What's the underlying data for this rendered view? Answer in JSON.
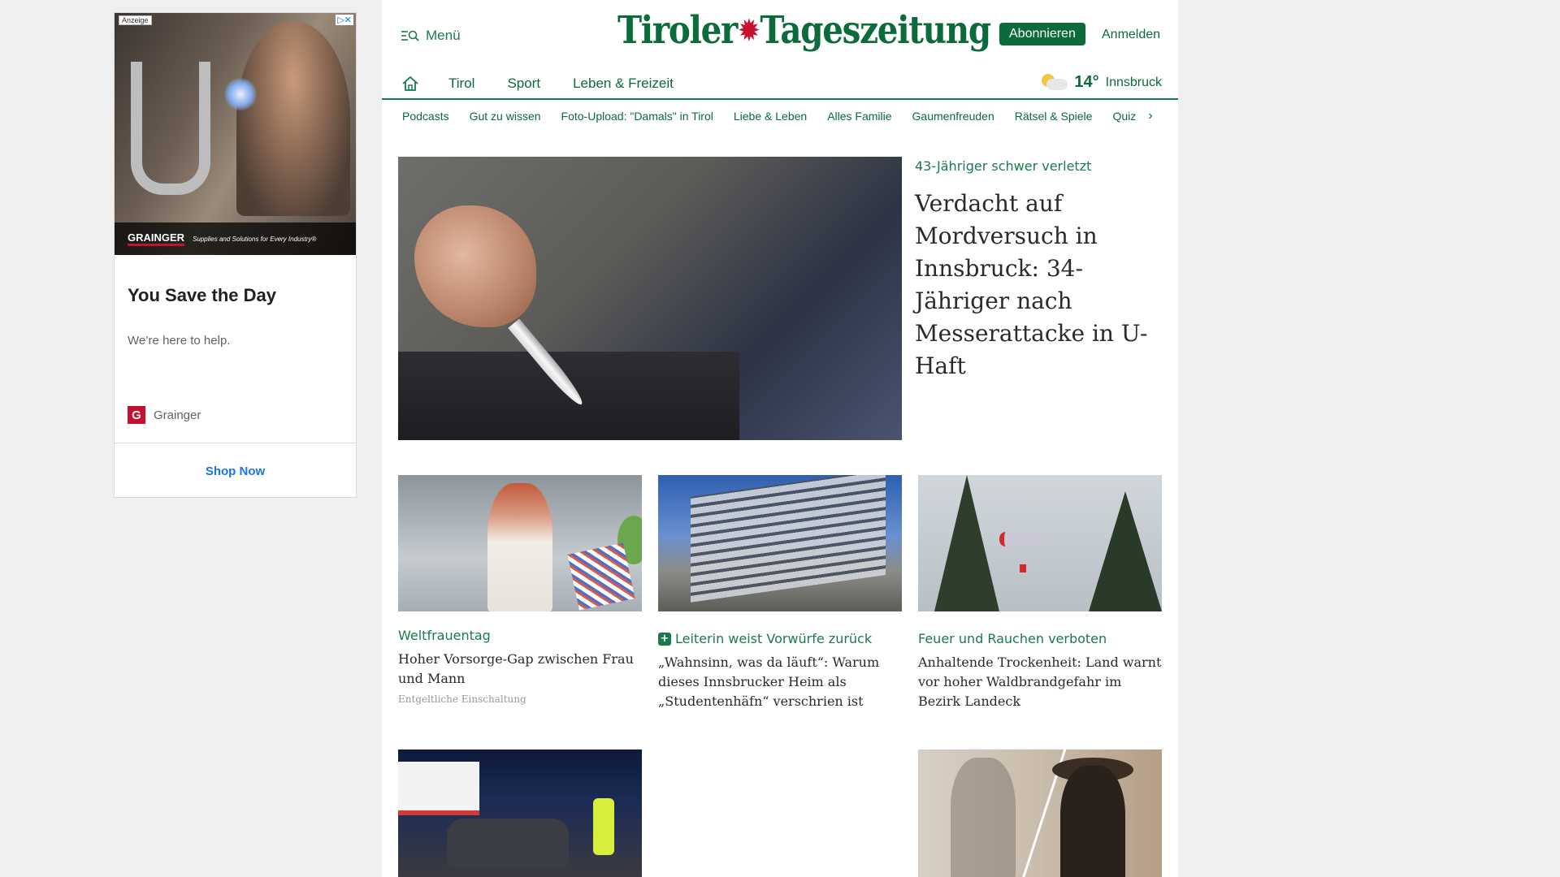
{
  "ad": {
    "tag": "Anzeige",
    "choices": "▷✕",
    "brand_name": "GRAINGER",
    "brand_slogan": "Supplies and Solutions for Every Industry®",
    "headline": "You Save the Day",
    "subline": "We’re here to help.",
    "logo_letter": "G",
    "advertiser": "Grainger",
    "cta": "Shop Now"
  },
  "header": {
    "menu_label": "Menü",
    "logo_left": "Tiroler",
    "logo_eagle": "✹",
    "logo_right": "Tageszeitung",
    "subscribe_label": "Abonnieren",
    "login_label": "Anmelden"
  },
  "mainnav": {
    "items": [
      "Tirol",
      "Sport",
      "Leben & Freizeit"
    ],
    "weather": {
      "temp": "14°",
      "city": "Innsbruck",
      "icon": "partly-cloudy-icon"
    }
  },
  "subnav": {
    "items": [
      "Podcasts",
      "Gut zu wissen",
      "Foto-Upload: \"Damals\" in Tirol",
      "Liebe & Leben",
      "Alles Familie",
      "Gaumenfreuden",
      "Rätsel & Spiele",
      "Quiz"
    ],
    "chevron": "›"
  },
  "hero": {
    "kicker": "43-Jähriger schwer verletzt",
    "title": "Verdacht auf Mordversuch in Innsbruck: 34-Jähriger nach Messerattacke in U-Haft"
  },
  "cards": [
    {
      "kicker": "Weltfrauentag",
      "title": "Hoher Vorsorge-Gap zwischen Frau und Mann",
      "note": "Entgeltliche Einschaltung",
      "plus": false
    },
    {
      "kicker": "Leiterin weist Vorwürfe zurück",
      "title": "„Wahnsinn, was da läuft“: Warum dieses Innsbrucker Heim als „Studentenhäfn“ verschrien ist",
      "plus": true,
      "plus_symbol": "+"
    },
    {
      "kicker": "Feuer und Rauchen verboten",
      "title": "Anhaltende Trockenheit: Land warnt vor hoher Waldbrandgefahr im Bezirk Landeck",
      "plus": false
    }
  ],
  "colors": {
    "brand_green": "#0b6b3a",
    "accent_red": "#c8102e",
    "ad_link_blue": "#1a73e8"
  }
}
